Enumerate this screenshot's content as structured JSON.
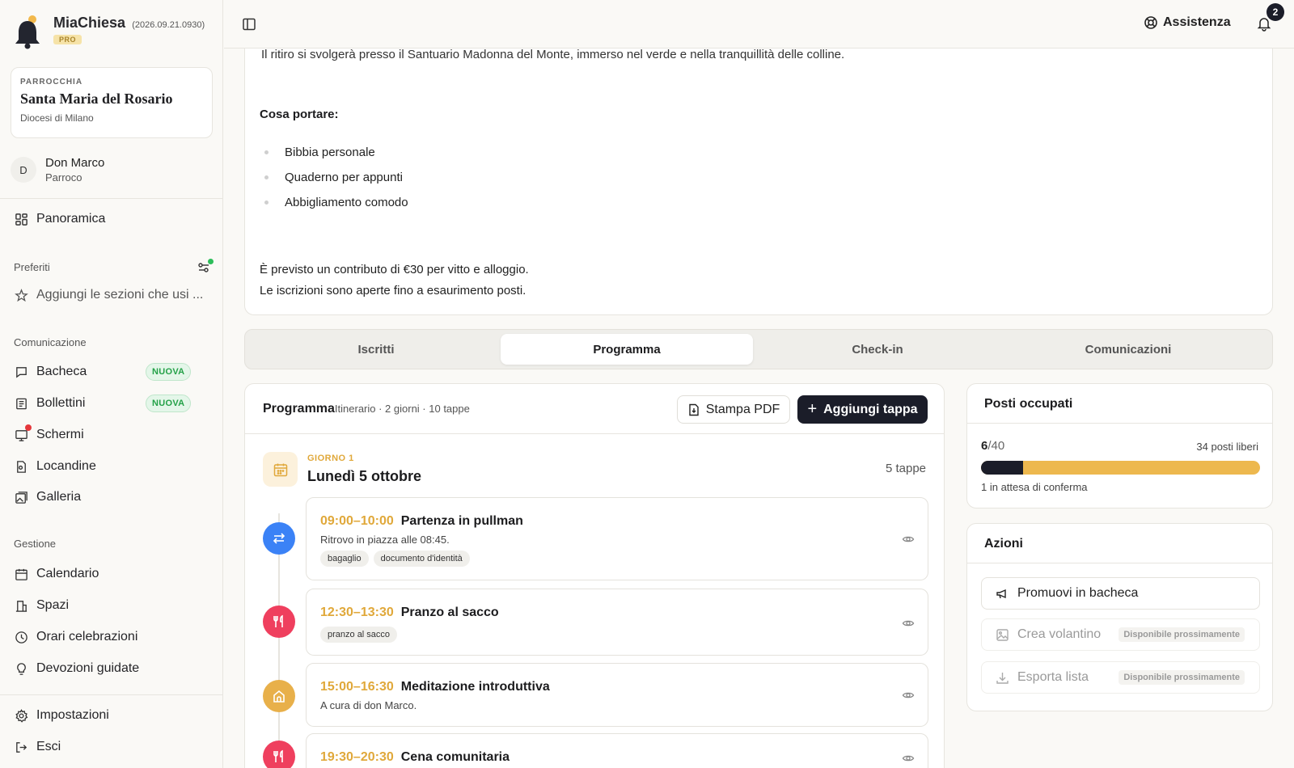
{
  "app": {
    "name": "MiaChiesa",
    "version": "(2026.09.21.0930)",
    "plan": "PRO"
  },
  "parish": {
    "kicker": "PARROCCHIA",
    "name": "Santa Maria del Rosario",
    "diocese": "Diocesi di Milano"
  },
  "user": {
    "initial": "D",
    "name": "Don Marco",
    "role": "Parroco"
  },
  "sidebar": {
    "overview": "Panoramica",
    "favorites_label": "Preferiti",
    "favorites_hint": "Aggiungi le sezioni che usi ...",
    "comm_label": "Comunicazione",
    "comm_items": [
      {
        "label": "Bacheca",
        "badge": "NUOVA"
      },
      {
        "label": "Bollettini",
        "badge": "NUOVA"
      },
      {
        "label": "Schermi"
      },
      {
        "label": "Locandine"
      },
      {
        "label": "Galleria"
      }
    ],
    "mgmt_label": "Gestione",
    "mgmt_items": [
      {
        "label": "Calendario"
      },
      {
        "label": "Spazi"
      },
      {
        "label": "Orari celebrazioni"
      },
      {
        "label": "Devozioni guidate"
      }
    ],
    "settings": "Impostazioni",
    "logout": "Esci"
  },
  "topbar": {
    "assist": "Assistenza",
    "notifications": "2"
  },
  "description": {
    "cut_line": "Il ritiro si svolgerà presso il Santuario Madonna del Monte, immerso nel verde e nella tranquillità delle colline.",
    "heading": "Cosa portare:",
    "items": [
      "Bibbia personale",
      "Quaderno per appunti",
      "Abbigliamento comodo"
    ],
    "note_1": "È previsto un contributo di €30 per vitto e alloggio.",
    "note_2": "Le iscrizioni sono aperte fino a esaurimento posti."
  },
  "tabs": [
    "Iscritti",
    "Programma",
    "Check-in",
    "Comunicazioni"
  ],
  "active_tab": "Programma",
  "program": {
    "title": "Programma",
    "subtitle": "Itinerario · 2 giorni · 10 tappe",
    "print_label": "Stampa PDF",
    "add_label": "Aggiungi tappa",
    "day": {
      "kicker": "GIORNO 1",
      "title": "Lunedì 5 ottobre",
      "count": "5 tappe"
    },
    "stops": [
      {
        "time": "09:00–10:00",
        "name": "Partenza in pullman",
        "desc": "Ritrovo in piazza alle 08:45.",
        "tags": [
          "bagaglio",
          "documento d'identità"
        ],
        "icon": "transfer-icon",
        "color": "#3b82f6"
      },
      {
        "time": "12:30–13:30",
        "name": "Pranzo al sacco",
        "desc": "",
        "tags": [
          "pranzo al sacco"
        ],
        "icon": "meal-icon",
        "color": "#ef3f5e"
      },
      {
        "time": "15:00–16:30",
        "name": "Meditazione introduttiva",
        "desc": "A cura di don Marco.",
        "tags": [],
        "icon": "church-icon",
        "color": "#e8b04a"
      },
      {
        "time": "19:30–20:30",
        "name": "Cena comunitaria",
        "desc": "",
        "tags": [],
        "icon": "meal-icon",
        "color": "#ef3f5e"
      }
    ]
  },
  "occupancy": {
    "title": "Posti occupati",
    "taken": "6",
    "total": "/40",
    "free": "34 posti liberi",
    "fraction": 0.15,
    "pending": "1 in attesa di conferma"
  },
  "actions": {
    "title": "Azioni",
    "promote": "Promuovi in bacheca",
    "flyer": "Crea volantino",
    "export": "Esporta lista",
    "soon": "Disponibile prossimamente"
  },
  "colors": {
    "accent": "#e0a83a",
    "dark": "#1b1d29",
    "new_badge": "#24a148"
  }
}
